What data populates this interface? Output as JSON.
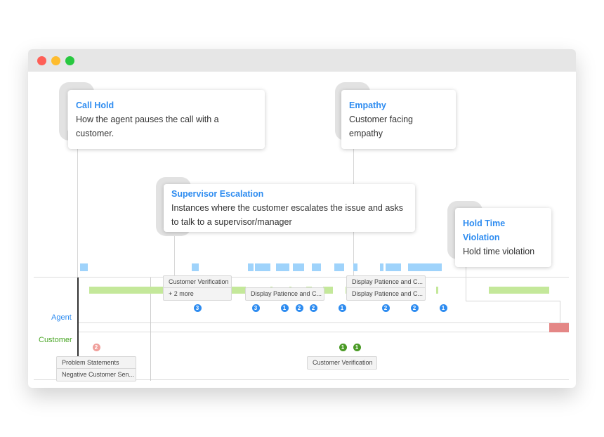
{
  "window": {
    "controls": [
      "close",
      "minimize",
      "maximize"
    ],
    "colors": {
      "close": "#fe5f57",
      "minimize": "#febc2e",
      "maximize": "#28c840"
    }
  },
  "callouts": [
    {
      "title": "Call Hold",
      "description": "How the agent pauses the call with a customer."
    },
    {
      "title": "Empathy",
      "description": "Customer facing empathy"
    },
    {
      "title": "Supervisor Escalation",
      "description": "Instances where the customer escalates the issue and asks to talk to a supervisor/manager"
    },
    {
      "title": "Hold Time Violation",
      "description": "Hold time violation"
    }
  ],
  "timeline": {
    "rows": [
      {
        "label": "Agent",
        "color": "#2e8cf0"
      },
      {
        "label": "Customer",
        "color": "#4aa626"
      }
    ],
    "agent_badges": [
      "3",
      "3",
      "1",
      "2",
      "2",
      "1",
      "2",
      "2",
      "1"
    ],
    "customer_badges": [
      "2",
      "1",
      "1"
    ],
    "tooltips": {
      "agent_1": [
        "Customer Verification",
        "+ 2 more"
      ],
      "agent_2": [
        "Display Patience and C..."
      ],
      "agent_3": [
        "Display Patience and C...",
        "Display Patience and C..."
      ],
      "customer_1": [
        "Problem Statements",
        "Negative Customer Sen..."
      ],
      "customer_2": [
        "Customer Verification"
      ]
    },
    "colors": {
      "agent_bar": "#9fd3fb",
      "customer_bar": "#c4e89a",
      "hold_violation": "#e48786",
      "agent_badge": "#2e8cf0",
      "customer_badge": "#4a9a25",
      "negative_badge": "#f0a09c"
    }
  }
}
